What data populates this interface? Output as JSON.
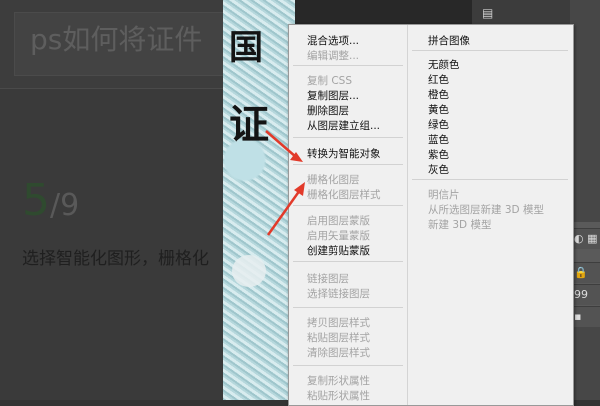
{
  "page": {
    "title": "ps如何将证件",
    "step_current": "5",
    "step_total": "/9",
    "step_text": "选择智能化图形，栅格化"
  },
  "canvas": {
    "char1": "国",
    "char2": "证"
  },
  "menu": {
    "left_items": [
      {
        "label": "混合选项...",
        "enabled": true
      },
      {
        "label": "编辑调整...",
        "enabled": false
      },
      {
        "label": "复制 CSS",
        "enabled": false
      },
      {
        "label": "复制图层...",
        "enabled": true
      },
      {
        "label": "删除图层",
        "enabled": true
      },
      {
        "label": "从图层建立组...",
        "enabled": true
      },
      {
        "label": "转换为智能对象",
        "enabled": true
      },
      {
        "label": "栅格化图层",
        "enabled": false
      },
      {
        "label": "栅格化图层样式",
        "enabled": false
      },
      {
        "label": "启用图层蒙版",
        "enabled": false
      },
      {
        "label": "启用矢量蒙版",
        "enabled": false
      },
      {
        "label": "创建剪贴蒙版",
        "enabled": true
      },
      {
        "label": "链接图层",
        "enabled": false
      },
      {
        "label": "选择链接图层",
        "enabled": false
      },
      {
        "label": "拷贝图层样式",
        "enabled": false
      },
      {
        "label": "粘贴图层样式",
        "enabled": false
      },
      {
        "label": "清除图层样式",
        "enabled": false
      },
      {
        "label": "复制形状属性",
        "enabled": false
      },
      {
        "label": "粘贴形状属性",
        "enabled": false
      }
    ],
    "right_items": [
      {
        "label": "拼合图像",
        "enabled": true
      },
      {
        "label": "无颜色",
        "enabled": true
      },
      {
        "label": "红色",
        "enabled": true
      },
      {
        "label": "橙色",
        "enabled": true
      },
      {
        "label": "黄色",
        "enabled": true
      },
      {
        "label": "绿色",
        "enabled": true
      },
      {
        "label": "蓝色",
        "enabled": true
      },
      {
        "label": "紫色",
        "enabled": true
      },
      {
        "label": "灰色",
        "enabled": true
      },
      {
        "label": "明信片",
        "enabled": false
      },
      {
        "label": "从所选图层新建 3D 模型",
        "enabled": false
      },
      {
        "label": "新建 3D 模型",
        "enabled": false
      }
    ]
  },
  "layers_panel": {
    "row_label": "99"
  },
  "colors": {
    "annotation_arrow": "#e23a2a",
    "step_number": "#2f4a2f",
    "menu_bg": "#f0f0f0"
  }
}
